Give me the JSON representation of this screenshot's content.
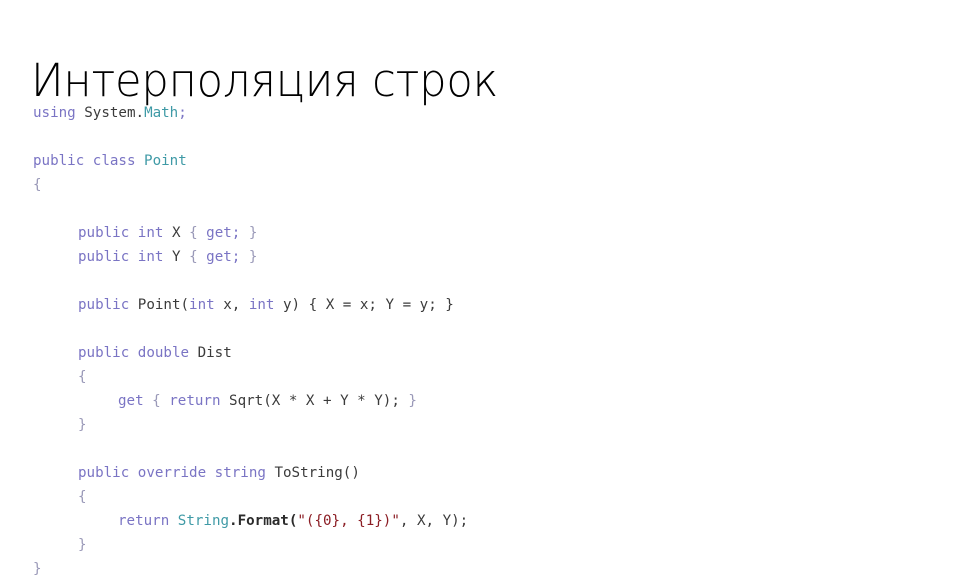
{
  "slide": {
    "title": "Интерполяция строк",
    "background_color": "#ffffff",
    "title_color": "#000000"
  },
  "colors": {
    "keyword": "#7a74c4",
    "type": "#3f9aa6",
    "plain": "#3b3b3b",
    "brace": "#9a99b8",
    "string": "#8b1d24",
    "method": "#2b2b2b"
  },
  "code": {
    "language": "csharp",
    "full_text": "using System.Math;\n\npublic class Point\n{\n    public int X { get; }\n    public int Y { get; }\n\n    public Point(int x, int y) { X = x; Y = y; }\n\n    public double Dist\n    {\n        get { return Sqrt(X * X + Y * Y); }\n    }\n\n    public override string ToString()\n    {\n        return String.Format(\"({0}, {1})\", X, Y);\n    }\n}",
    "lines": [
      {
        "id": "l1",
        "indent": 0,
        "gap": false,
        "text": "using System.Math;"
      },
      {
        "id": "l2",
        "indent": 0,
        "gap": true,
        "text": "public class Point"
      },
      {
        "id": "l3",
        "indent": 0,
        "gap": false,
        "text": "{"
      },
      {
        "id": "l4",
        "indent": 1,
        "gap": true,
        "text": "public int X { get; }"
      },
      {
        "id": "l5",
        "indent": 1,
        "gap": false,
        "text": "public int Y { get; }"
      },
      {
        "id": "l6",
        "indent": 1,
        "gap": true,
        "text": "public Point(int x, int y) { X = x; Y = y; }"
      },
      {
        "id": "l7",
        "indent": 1,
        "gap": true,
        "text": "public double Dist"
      },
      {
        "id": "l8",
        "indent": 1,
        "gap": false,
        "text": "{"
      },
      {
        "id": "l9",
        "indent": 2,
        "gap": false,
        "text": "get { return Sqrt(X * X + Y * Y); }"
      },
      {
        "id": "l10",
        "indent": 1,
        "gap": false,
        "text": "}"
      },
      {
        "id": "l11",
        "indent": 1,
        "gap": true,
        "text": "public override string ToString()"
      },
      {
        "id": "l12",
        "indent": 1,
        "gap": false,
        "text": "{"
      },
      {
        "id": "l13",
        "indent": 2,
        "gap": false,
        "text": "return String.Format(\"({0}, {1})\", X, Y);"
      },
      {
        "id": "l14",
        "indent": 1,
        "gap": false,
        "text": "}"
      },
      {
        "id": "l15",
        "indent": 0,
        "gap": false,
        "text": "}"
      }
    ],
    "tokens": {
      "l1": [
        {
          "t": "using",
          "c": "kw"
        },
        {
          "t": " System.",
          "c": "pln"
        },
        {
          "t": "Math",
          "c": "typ"
        },
        {
          "t": ";",
          "c": "pnc"
        }
      ],
      "l2": [
        {
          "t": "public class ",
          "c": "kw"
        },
        {
          "t": "Point",
          "c": "typ"
        }
      ],
      "l3": [
        {
          "t": "{",
          "c": "brc"
        }
      ],
      "l4": [
        {
          "t": "public int ",
          "c": "kw"
        },
        {
          "t": "X ",
          "c": "pln"
        },
        {
          "t": "{ ",
          "c": "brc"
        },
        {
          "t": "get;",
          "c": "kw"
        },
        {
          "t": " }",
          "c": "brc"
        }
      ],
      "l5": [
        {
          "t": "public int ",
          "c": "kw"
        },
        {
          "t": "Y ",
          "c": "pln"
        },
        {
          "t": "{ ",
          "c": "brc"
        },
        {
          "t": "get;",
          "c": "kw"
        },
        {
          "t": " }",
          "c": "brc"
        }
      ],
      "l6": [
        {
          "t": "public ",
          "c": "kw"
        },
        {
          "t": "Point(",
          "c": "pln"
        },
        {
          "t": "int",
          "c": "kw"
        },
        {
          "t": " x, ",
          "c": "pln"
        },
        {
          "t": "int",
          "c": "kw"
        },
        {
          "t": " y) { X = x; Y = y; }",
          "c": "pln"
        }
      ],
      "l7": [
        {
          "t": "public double ",
          "c": "kw"
        },
        {
          "t": "Dist",
          "c": "pln"
        }
      ],
      "l8": [
        {
          "t": "{",
          "c": "brc"
        }
      ],
      "l9": [
        {
          "t": "get",
          "c": "kw"
        },
        {
          "t": " { ",
          "c": "brc"
        },
        {
          "t": "return",
          "c": "kw"
        },
        {
          "t": " Sqrt(X * X + Y * Y);",
          "c": "pln"
        },
        {
          "t": " }",
          "c": "brc"
        }
      ],
      "l10": [
        {
          "t": "}",
          "c": "brc"
        }
      ],
      "l11": [
        {
          "t": "public override string ",
          "c": "kw"
        },
        {
          "t": "ToString()",
          "c": "pln"
        }
      ],
      "l12": [
        {
          "t": "{",
          "c": "brc"
        }
      ],
      "l13": [
        {
          "t": "return ",
          "c": "kw"
        },
        {
          "t": "String",
          "c": "typ"
        },
        {
          "t": ".Format(",
          "c": "mth"
        },
        {
          "t": "\"({0}, {1})\"",
          "c": "str"
        },
        {
          "t": ", X, Y);",
          "c": "pln"
        }
      ],
      "l14": [
        {
          "t": "}",
          "c": "brc"
        }
      ],
      "l15": [
        {
          "t": "}",
          "c": "brc"
        }
      ]
    }
  }
}
